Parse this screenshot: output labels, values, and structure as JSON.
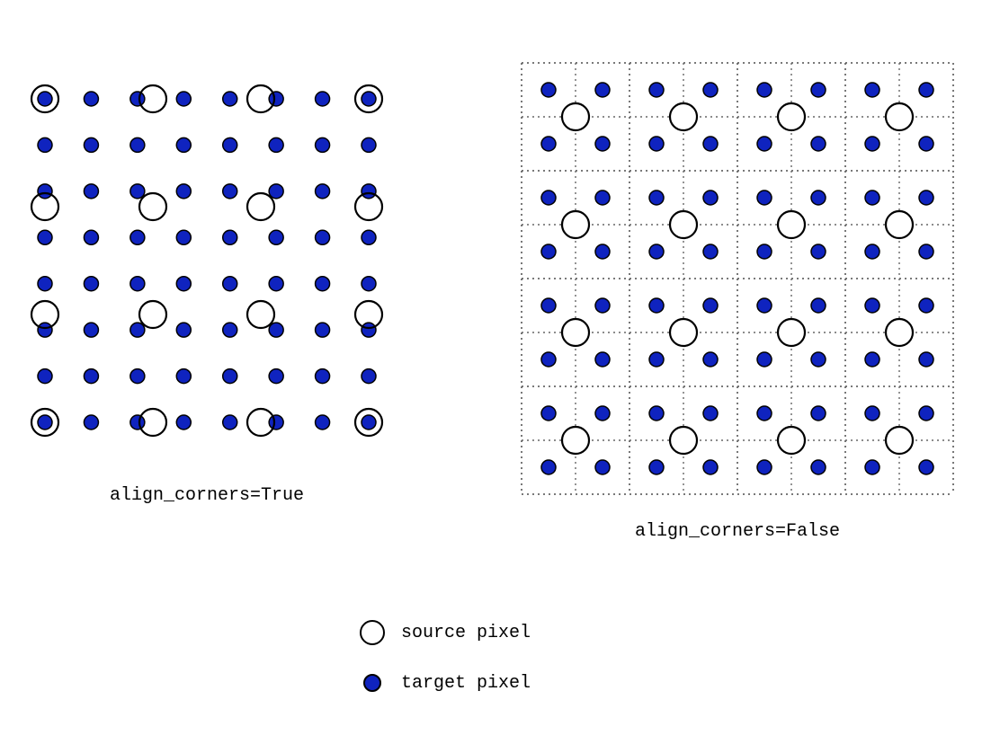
{
  "diagram": {
    "left_caption": "align_corners=True",
    "right_caption": "align_corners=False",
    "colors": {
      "target_fill": "#0f23bf",
      "stroke": "#000000",
      "grid_stroke": "#666666",
      "bg": "#ffffff"
    },
    "source_grid": {
      "rows": 4,
      "cols": 4
    },
    "target_grid": {
      "rows": 8,
      "cols": 8
    },
    "left": {
      "note": "align_corners=True: source pixels span the full range; targets sit on a 8x8 lattice over the same span; corners coincide."
    },
    "right": {
      "note": "align_corners=False: targets at pixel centers of an 8x8 grid of cells; sources at centers of a 4x4 coarser cell grid; dotted lines show cell boundaries."
    },
    "legend": {
      "source_label": "source pixel",
      "target_label": "target pixel"
    }
  },
  "chart_data": {
    "type": "diagram",
    "title": "Interpolation align_corners True vs False",
    "panels": [
      {
        "name": "align_corners=True",
        "source_points_grid": "4x4 over [0,1]x[0,1] at i/3, j/3",
        "target_points_grid": "8x8 over [0,1]x[0,1] at i/7, j/7"
      },
      {
        "name": "align_corners=False",
        "source_points_grid": "4x4 centers at (i+0.5)/4, (j+0.5)/4",
        "target_points_grid": "8x8 centers at (i+0.5)/8, (j+0.5)/8",
        "cell_boundaries": "dotted lines at k/4 and k/8 for k=0..N"
      }
    ],
    "legend": [
      "source pixel (open circle)",
      "target pixel (filled blue)"
    ]
  }
}
